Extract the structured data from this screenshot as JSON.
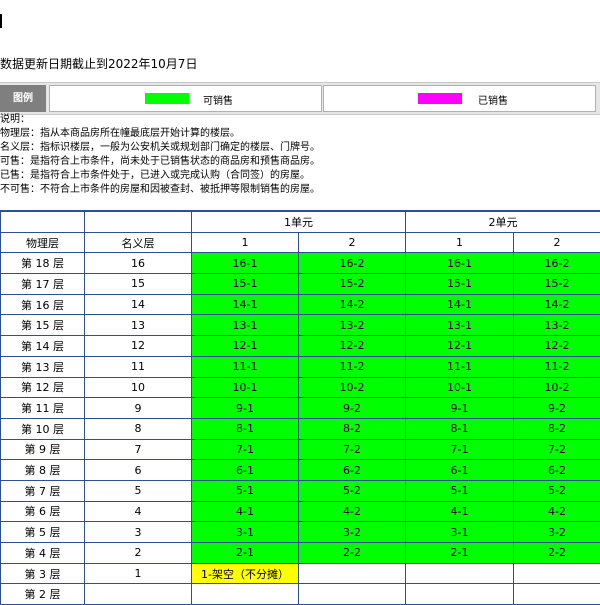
{
  "header": {
    "update_date": "数据更新日期截止到2022年10月7日"
  },
  "legend": {
    "label": "图例",
    "items": [
      {
        "label": "可销售",
        "color": "#00ff00"
      },
      {
        "label": "已销售",
        "color": "#ff00ff"
      }
    ]
  },
  "notes": [
    "说明：",
    "物理层：指从本商品房所在幢最底层开始计算的楼层。",
    "名义层：指标识楼层，一般为公安机关或规划部门确定的楼层、门牌号。",
    "可售：是指符合上市条件，尚未处于已销售状态的商品房和预售商品房。",
    "已售：是指符合上市条件处于，已进入或完成认购（合同签）的房屋。",
    "不可售：不符合上市条件的房屋和因被查封、被抵押等限制销售的房屋。"
  ],
  "colors": {
    "available": "#00ff00",
    "sold": "#ff00ff",
    "special": "#ffff00",
    "grid": "#2f4f91"
  },
  "table": {
    "col_physical": "物理层",
    "col_nominal": "名义层",
    "units": [
      {
        "name": "1单元",
        "rooms": [
          "1",
          "2"
        ]
      },
      {
        "name": "2单元",
        "rooms": [
          "1",
          "2"
        ]
      }
    ],
    "rows": [
      {
        "physical": "第 18 层",
        "nominal": "16",
        "cells": [
          "16-1",
          "16-2",
          "16-1",
          "16-2"
        ],
        "status": "available"
      },
      {
        "physical": "第 17 层",
        "nominal": "15",
        "cells": [
          "15-1",
          "15-2",
          "15-1",
          "15-2"
        ],
        "status": "available"
      },
      {
        "physical": "第 16 层",
        "nominal": "14",
        "cells": [
          "14-1",
          "14-2",
          "14-1",
          "14-2"
        ],
        "status": "available"
      },
      {
        "physical": "第 15 层",
        "nominal": "13",
        "cells": [
          "13-1",
          "13-2",
          "13-1",
          "13-2"
        ],
        "status": "available"
      },
      {
        "physical": "第 14 层",
        "nominal": "12",
        "cells": [
          "12-1",
          "12-2",
          "12-1",
          "12-2"
        ],
        "status": "available"
      },
      {
        "physical": "第 13 层",
        "nominal": "11",
        "cells": [
          "11-1",
          "11-2",
          "11-1",
          "11-2"
        ],
        "status": "available"
      },
      {
        "physical": "第 12 层",
        "nominal": "10",
        "cells": [
          "10-1",
          "10-2",
          "10-1",
          "10-2"
        ],
        "status": "available"
      },
      {
        "physical": "第 11 层",
        "nominal": "9",
        "cells": [
          "9-1",
          "9-2",
          "9-1",
          "9-2"
        ],
        "status": "available"
      },
      {
        "physical": "第 10 层",
        "nominal": "8",
        "cells": [
          "8-1",
          "8-2",
          "8-1",
          "8-2"
        ],
        "status": "available"
      },
      {
        "physical": "第 9 层",
        "nominal": "7",
        "cells": [
          "7-1",
          "7-2",
          "7-1",
          "7-2"
        ],
        "status": "available"
      },
      {
        "physical": "第 8 层",
        "nominal": "6",
        "cells": [
          "6-1",
          "6-2",
          "6-1",
          "6-2"
        ],
        "status": "available"
      },
      {
        "physical": "第 7 层",
        "nominal": "5",
        "cells": [
          "5-1",
          "5-2",
          "5-1",
          "5-2"
        ],
        "status": "available"
      },
      {
        "physical": "第 6 层",
        "nominal": "4",
        "cells": [
          "4-1",
          "4-2",
          "4-1",
          "4-2"
        ],
        "status": "available"
      },
      {
        "physical": "第 5 层",
        "nominal": "3",
        "cells": [
          "3-1",
          "3-2",
          "3-1",
          "3-2"
        ],
        "status": "available"
      },
      {
        "physical": "第 4 层",
        "nominal": "2",
        "cells": [
          "2-1",
          "2-2",
          "2-1",
          "2-2"
        ],
        "status": "available"
      },
      {
        "physical": "第 3 层",
        "nominal": "1",
        "cells": [
          "1-架空（不分摊）",
          "",
          "",
          ""
        ],
        "status": "special"
      },
      {
        "physical": "第 2 层",
        "nominal": "",
        "cells": [
          "",
          "",
          "",
          ""
        ],
        "status": "empty"
      }
    ]
  }
}
